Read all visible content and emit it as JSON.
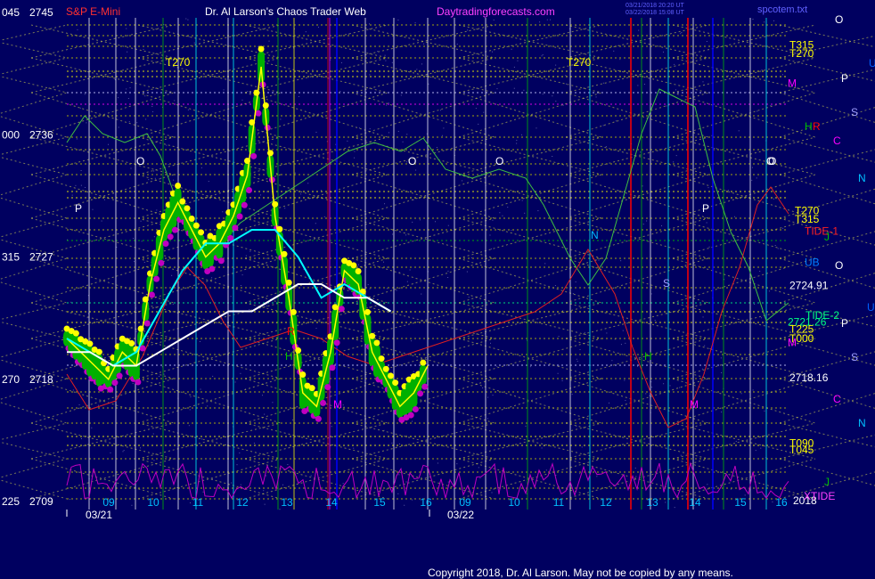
{
  "header": {
    "title_left": "S&P E-Mini",
    "title_center": "Dr. Al Larson's Chaos Trader Web",
    "site": "Daytradingforecasts.com",
    "stamp1": "03/21/2018 20:20 UT",
    "stamp2": "03/22/2018 15:08 UT",
    "file": "spcotem.txt"
  },
  "footer": {
    "copyright": "Copyright 2018, Dr. Al Larson. May not be copied by any means."
  },
  "colors": {
    "background": "#000060",
    "price": "#ffff00",
    "ma_fast": "#00ffff",
    "ma_slow": "#ffffff",
    "bars": "#00c000"
  },
  "chart_data": {
    "type": "line",
    "ylim": [
      2709,
      2748
    ],
    "y_ticks": [
      {
        "left": "045",
        "right": "2745",
        "value": 2745
      },
      {
        "left": "000",
        "right": "2736",
        "value": 2736
      },
      {
        "left": "315",
        "right": "2727",
        "value": 2727
      },
      {
        "left": "270",
        "right": "2718",
        "value": 2718
      },
      {
        "left": "225",
        "right": "2709",
        "value": 2709
      }
    ],
    "x_ticks": [
      "09",
      "10",
      "11",
      "12",
      "13",
      "14",
      "15",
      "16",
      "09",
      "10",
      "11",
      "12",
      "13",
      "14",
      "15",
      "16"
    ],
    "date_labels": [
      "03/21",
      "03/22"
    ],
    "year_label": "2018",
    "series": [
      {
        "name": "S&P E-Mini",
        "x": [
          0.0,
          0.3,
          0.6,
          0.9,
          1.2,
          1.5,
          1.8,
          2.1,
          2.4,
          2.7,
          3.0,
          3.3,
          3.6,
          3.9,
          4.2,
          4.5,
          4.8,
          5.1,
          5.4,
          5.7,
          6.0,
          6.3,
          6.6,
          6.9,
          7.2,
          7.5,
          7.8
        ],
        "values": [
          2721,
          2720,
          2719,
          2718,
          2720,
          2719,
          2725,
          2729,
          2731,
          2729,
          2727,
          2728,
          2730,
          2733,
          2741,
          2730,
          2724,
          2717,
          2716,
          2720,
          2726,
          2725,
          2720,
          2718,
          2716,
          2717,
          2719
        ]
      },
      {
        "name": "",
        "x": [
          0.0,
          0.5,
          1.0,
          1.5,
          2.0,
          2.5,
          3.0,
          3.5,
          4.0,
          4.5,
          5.0,
          5.5,
          6.0,
          6.5,
          7.0
        ],
        "values": [
          2721,
          2720,
          2719,
          2720,
          2723,
          2726,
          2728,
          2728,
          2729,
          2729,
          2727,
          2724,
          2725,
          2724,
          2723
        ]
      },
      {
        "name": "",
        "x": [
          0.0,
          0.5,
          1.0,
          1.5,
          2.0,
          2.5,
          3.0,
          3.5,
          4.0,
          4.5,
          5.0,
          5.5,
          6.0,
          6.5,
          7.0
        ],
        "values": [
          2720,
          2720,
          2719,
          2719,
          2720,
          2721,
          2722,
          2723,
          2723,
          2724,
          2725,
          2725,
          2724,
          2724,
          2723
        ]
      }
    ],
    "right_labels": [
      {
        "text": "T315",
        "value": 2742.6,
        "color": "#ffff00"
      },
      {
        "text": "T270",
        "value": 2742.0,
        "color": "#ffff00"
      },
      {
        "text": "M",
        "value": 2739.8,
        "color": "#ff00ff"
      },
      {
        "text": "H",
        "value": 2736.6,
        "color": "#00c000"
      },
      {
        "text": "R",
        "value": 2736.6,
        "color": "#ff0000"
      },
      {
        "text": "T270",
        "value": 2730.4,
        "color": "#ffff00"
      },
      {
        "text": "T315",
        "value": 2729.8,
        "color": "#ffff00"
      },
      {
        "text": "TIDE-1",
        "value": 2728.9,
        "color": "#ff2020"
      },
      {
        "text": "UB",
        "value": 2726.6,
        "color": "#0080ff"
      },
      {
        "text": "2724.91",
        "value": 2724.9,
        "color": "#ffffff"
      },
      {
        "text": "TIDE-2",
        "value": 2722.7,
        "color": "#00ff80"
      },
      {
        "text": "2721.26",
        "value": 2722.2,
        "color": "#00ff80"
      },
      {
        "text": "T225",
        "value": 2721.7,
        "color": "#ffff00"
      },
      {
        "text": "T000",
        "value": 2721.0,
        "color": "#ffff00"
      },
      {
        "text": "M",
        "value": 2720.7,
        "color": "#ff00ff"
      },
      {
        "text": "2718.16",
        "value": 2718.1,
        "color": "#ffffff"
      },
      {
        "text": "T090",
        "value": 2713.3,
        "color": "#ffff00"
      },
      {
        "text": "T045",
        "value": 2712.8,
        "color": "#ffff00"
      },
      {
        "text": "XTIDE",
        "value": 2709.4,
        "color": "#ff40ff"
      }
    ],
    "annotations": [
      "T270",
      "T270",
      "O",
      "O",
      "O",
      "O",
      "O",
      "P",
      "P",
      "N",
      "S",
      "H",
      "M",
      "R",
      "H",
      "M"
    ],
    "side_letters": [
      {
        "text": "O",
        "color": "#ffffff"
      },
      {
        "text": "U",
        "color": "#0060ff"
      },
      {
        "text": "P",
        "color": "#ffffff"
      },
      {
        "text": "S",
        "color": "#a0a0ff"
      },
      {
        "text": "C",
        "color": "#ff00ff"
      },
      {
        "text": "N",
        "color": "#00c0ff"
      },
      {
        "text": "J",
        "color": "#00c000"
      },
      {
        "text": "O",
        "color": "#ffffff"
      },
      {
        "text": "U",
        "color": "#0060ff"
      },
      {
        "text": "P",
        "color": "#ffffff"
      },
      {
        "text": "S",
        "color": "#a0a0ff"
      },
      {
        "text": "C",
        "color": "#ff00ff"
      },
      {
        "text": "N",
        "color": "#00c0ff"
      },
      {
        "text": "J",
        "color": "#00c000"
      }
    ],
    "grid": true
  }
}
